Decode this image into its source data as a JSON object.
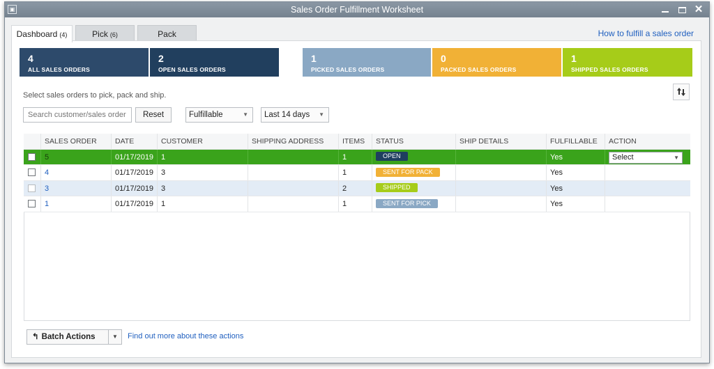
{
  "window": {
    "title": "Sales Order Fulfillment Worksheet",
    "sys_icon": "▣"
  },
  "tabs": [
    {
      "label": "Dashboard",
      "count": "(4)"
    },
    {
      "label": "Pick",
      "count": "(6)"
    },
    {
      "label": "Pack",
      "count": ""
    }
  ],
  "help_link": "How to fulfill a sales order",
  "tiles": [
    {
      "number": "4",
      "label": "ALL SALES ORDERS",
      "color": "#2d4a6b"
    },
    {
      "number": "2",
      "label": "OPEN SALES ORDERS",
      "color": "#213f5e"
    },
    {
      "number": "1",
      "label": "PICKED SALES ORDERS",
      "color": "#8aa8c4"
    },
    {
      "number": "0",
      "label": "PACKED SALES ORDERS",
      "color": "#f1b136"
    },
    {
      "number": "1",
      "label": "SHIPPED SALES ORDERS",
      "color": "#a6cc19"
    }
  ],
  "instructions": "Select sales orders to pick, pack and ship.",
  "search": {
    "placeholder": "Search customer/sales order"
  },
  "reset_label": "Reset",
  "filters": {
    "status": "Fulfillable",
    "period": "Last 14 days"
  },
  "table": {
    "columns": [
      "SALES ORDER",
      "DATE",
      "CUSTOMER",
      "SHIPPING ADDRESS",
      "ITEMS",
      "STATUS",
      "SHIP DETAILS",
      "FULFILLABLE",
      "ACTION"
    ],
    "rows": [
      {
        "order": "5",
        "date": "01/17/2019",
        "customer": "1",
        "address": "",
        "items": "1",
        "status": "OPEN",
        "status_color": "#1f3f5f",
        "ship": "",
        "fulfillable": "Yes",
        "action": "Select"
      },
      {
        "order": "4",
        "date": "01/17/2019",
        "customer": "3",
        "address": "",
        "items": "1",
        "status": "SENT FOR PACK",
        "status_color": "#f1b136",
        "ship": "",
        "fulfillable": "Yes",
        "action": ""
      },
      {
        "order": "3",
        "date": "01/17/2019",
        "customer": "3",
        "address": "",
        "items": "2",
        "status": "SHIPPED",
        "status_color": "#a6cc19",
        "ship": "",
        "fulfillable": "Yes",
        "action": ""
      },
      {
        "order": "1",
        "date": "01/17/2019",
        "customer": "1",
        "address": "",
        "items": "1",
        "status": "SENT FOR PICK",
        "status_color": "#8aa8c4",
        "ship": "",
        "fulfillable": "Yes",
        "action": ""
      }
    ]
  },
  "batch_actions_label": "Batch Actions",
  "find_more_link": "Find out more about these actions"
}
